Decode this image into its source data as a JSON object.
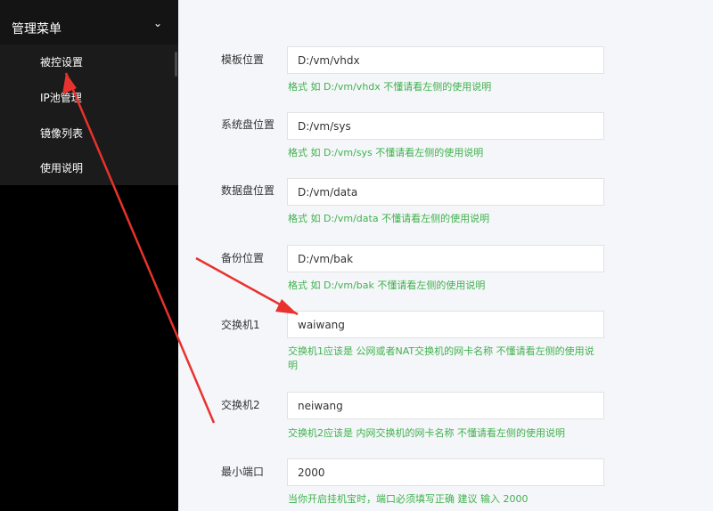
{
  "sidebar": {
    "menu_title": "管理菜单",
    "chevron_icon": "chevron-down-icon",
    "items": [
      {
        "label": "被控设置"
      },
      {
        "label": "IP池管理"
      },
      {
        "label": "镜像列表"
      },
      {
        "label": "使用说明"
      }
    ]
  },
  "form": {
    "rows": [
      {
        "label": "模板位置",
        "value": "D:/vm/vhdx",
        "hint": "格式 如 D:/vm/vhdx 不懂请看左侧的使用说明"
      },
      {
        "label": "系统盘位置",
        "value": "D:/vm/sys",
        "hint": "格式 如 D:/vm/sys 不懂请看左侧的使用说明"
      },
      {
        "label": "数据盘位置",
        "value": "D:/vm/data",
        "hint": "格式 如 D:/vm/data 不懂请看左侧的使用说明"
      },
      {
        "label": "备份位置",
        "value": "D:/vm/bak",
        "hint": "格式 如 D:/vm/bak 不懂请看左侧的使用说明"
      },
      {
        "label": "交换机1",
        "value": "waiwang",
        "hint": "交换机1应该是 公网或者NAT交换机的网卡名称 不懂请看左侧的使用说明"
      },
      {
        "label": "交换机2",
        "value": "neiwang",
        "hint": "交换机2应该是 内网交换机的网卡名称 不懂请看左侧的使用说明"
      },
      {
        "label": "最小端口",
        "value": "2000",
        "hint": "当你开启挂机宝时，端口必须填写正确 建议 输入 2000"
      }
    ]
  },
  "colors": {
    "sidebar_bg": "#000000",
    "hint_green": "#3fb24c",
    "arrow_red": "#e8322d"
  }
}
